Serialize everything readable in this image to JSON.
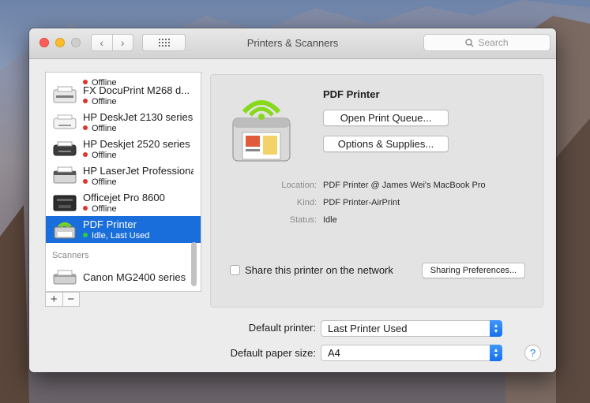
{
  "window": {
    "title": "Printers & Scanners"
  },
  "toolbar": {
    "back_glyph": "‹",
    "forward_glyph": "›",
    "grid_glyph": "⋮⋮⋮"
  },
  "search": {
    "placeholder": "Search"
  },
  "printers": [
    {
      "name": "",
      "status": "Offline",
      "status_color": "red"
    },
    {
      "name": "FX DocuPrint M268 d...",
      "status": "Offline",
      "status_color": "red"
    },
    {
      "name": "HP DeskJet 2130 series",
      "status": "Offline",
      "status_color": "red"
    },
    {
      "name": "HP Deskjet 2520 series",
      "status": "Offline",
      "status_color": "red"
    },
    {
      "name": "HP LaserJet Professional",
      "status": "Offline",
      "status_color": "red"
    },
    {
      "name": "Officejet Pro 8600",
      "status": "Offline",
      "status_color": "red"
    },
    {
      "name": "PDF Printer",
      "status": "Idle, Last Used",
      "status_color": "green",
      "selected": true
    }
  ],
  "scanners_header": "Scanners",
  "scanners": [
    {
      "name": "Canon MG2400 series"
    }
  ],
  "list_buttons": {
    "add": "+",
    "remove": "−"
  },
  "detail": {
    "title": "PDF Printer",
    "open_queue_button": "Open Print Queue...",
    "options_button": "Options & Supplies...",
    "location_label": "Location:",
    "location_value": "PDF Printer @ James Wei's MacBook Pro",
    "kind_label": "Kind:",
    "kind_value": "PDF Printer-AirPrint",
    "status_label": "Status:",
    "status_value": "Idle",
    "share_label": "Share this printer on the network",
    "share_checked": false,
    "sharing_prefs_button": "Sharing Preferences..."
  },
  "footer": {
    "default_printer_label": "Default printer:",
    "default_printer_value": "Last Printer Used",
    "paper_size_label": "Default paper size:",
    "paper_size_value": "A4",
    "help": "?"
  },
  "colors": {
    "selection": "#1a6edb",
    "accent": "#1670ed",
    "offline": "#e0352d",
    "online": "#2bd03d"
  }
}
